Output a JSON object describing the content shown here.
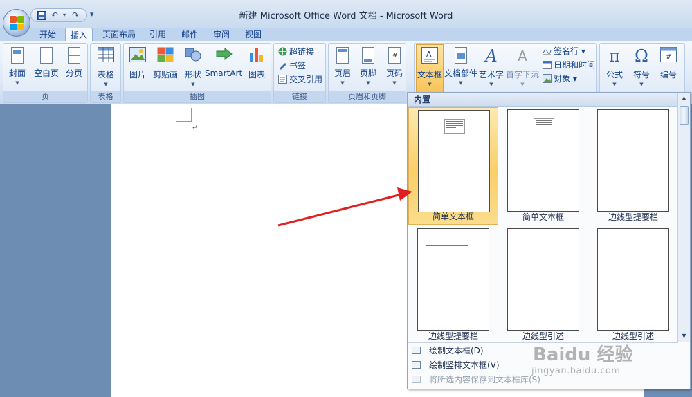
{
  "window": {
    "title": "新建 Microsoft Office Word 文档 - Microsoft Word"
  },
  "quick_access": {
    "icons": [
      "save-icon",
      "undo-icon",
      "redo-icon"
    ],
    "more": "▾"
  },
  "tabs": [
    {
      "label": "开始",
      "active": false
    },
    {
      "label": "插入",
      "active": true
    },
    {
      "label": "页面布局",
      "active": false
    },
    {
      "label": "引用",
      "active": false
    },
    {
      "label": "邮件",
      "active": false
    },
    {
      "label": "审阅",
      "active": false
    },
    {
      "label": "视图",
      "active": false
    }
  ],
  "ribbon": {
    "groups": {
      "page": {
        "label": "页",
        "buttons": [
          "封面",
          "空白页",
          "分页"
        ]
      },
      "table": {
        "label": "表格",
        "buttons": [
          "表格"
        ]
      },
      "illustrations": {
        "label": "插图",
        "buttons": [
          "图片",
          "剪贴画",
          "形状",
          "SmartArt",
          "图表"
        ]
      },
      "links": {
        "label": "链接",
        "buttons": [
          "超链接",
          "书签",
          "交叉引用"
        ]
      },
      "header_footer": {
        "label": "页眉和页脚",
        "buttons": [
          "页眉",
          "页脚",
          "页码"
        ]
      },
      "text": {
        "buttons": [
          "文本框",
          "文档部件",
          "艺术字",
          "首字下沉"
        ],
        "small": [
          "签名行",
          "日期和时间",
          "对象"
        ]
      },
      "symbols": {
        "buttons": [
          "公式",
          "符号",
          "编号"
        ]
      }
    }
  },
  "document": {
    "paragraph_mark": "↵"
  },
  "gallery": {
    "header": "内置",
    "tiles": [
      {
        "caption": "简单文本框",
        "selected": true
      },
      {
        "caption": "简单文本框",
        "selected": false
      },
      {
        "caption": "边线型提要栏",
        "selected": false
      },
      {
        "caption": "边线型提要栏",
        "selected": false
      },
      {
        "caption": "边线型引述",
        "selected": false
      },
      {
        "caption": "边线型引述",
        "selected": false
      }
    ],
    "menu": [
      {
        "label": "绘制文本框(D)",
        "enabled": true
      },
      {
        "label": "绘制竖排文本框(V)",
        "enabled": true
      },
      {
        "label": "将所选内容保存到文本框库(S)",
        "enabled": false
      }
    ]
  },
  "watermark": {
    "line1": "Baidu 经验",
    "line2": "jingyan.baidu.com"
  },
  "colors": {
    "annotation_arrow": "#e02020",
    "selected_tile": "#f9cf68",
    "ribbon_text": "#15428b"
  }
}
